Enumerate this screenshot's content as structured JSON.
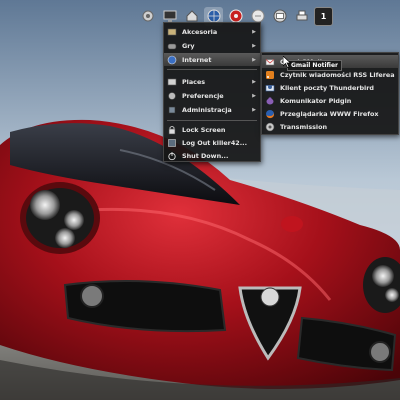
{
  "dock": {
    "icons": [
      "settings-icon",
      "monitor-icon",
      "home-icon",
      "globe-icon",
      "media-icon",
      "chat-icon",
      "mail-icon",
      "print-icon",
      "workspace-icon"
    ],
    "workspace_number": "1"
  },
  "main_menu": {
    "items": [
      {
        "label": "Akcesoria",
        "icon": "accessories-icon",
        "has_submenu": true
      },
      {
        "label": "Gry",
        "icon": "games-icon",
        "has_submenu": true
      },
      {
        "label": "Internet",
        "icon": "internet-icon",
        "has_submenu": true,
        "highlighted": true
      },
      {
        "label": "Places",
        "icon": "places-icon",
        "has_submenu": true
      },
      {
        "label": "Preferencje",
        "icon": "preferences-icon",
        "has_submenu": true
      },
      {
        "label": "Administracja",
        "icon": "administration-icon",
        "has_submenu": true
      },
      {
        "label": "Lock Screen",
        "icon": "lock-icon"
      },
      {
        "label": "Log Out killer42...",
        "icon": "logout-icon"
      },
      {
        "label": "Shut Down...",
        "icon": "shutdown-icon"
      }
    ]
  },
  "submenu": {
    "items": [
      {
        "label": "CheckGMail",
        "icon": "mail-icon",
        "highlighted": true
      },
      {
        "label": "Czytnik wiadomości RSS Liferea",
        "icon": "rss-icon"
      },
      {
        "label": "Klient poczty Thunderbird",
        "icon": "thunderbird-icon"
      },
      {
        "label": "Komunikator Pidgin",
        "icon": "pidgin-icon"
      },
      {
        "label": "Przeglądarka WWW Firefox",
        "icon": "firefox-icon"
      },
      {
        "label": "Transmission",
        "icon": "transmission-icon"
      }
    ]
  },
  "tooltip": {
    "text": "Gmail Notifier"
  },
  "colors": {
    "car_red": "#b0121c",
    "menu_bg": "#161616",
    "highlight": "#4a4a4a"
  }
}
